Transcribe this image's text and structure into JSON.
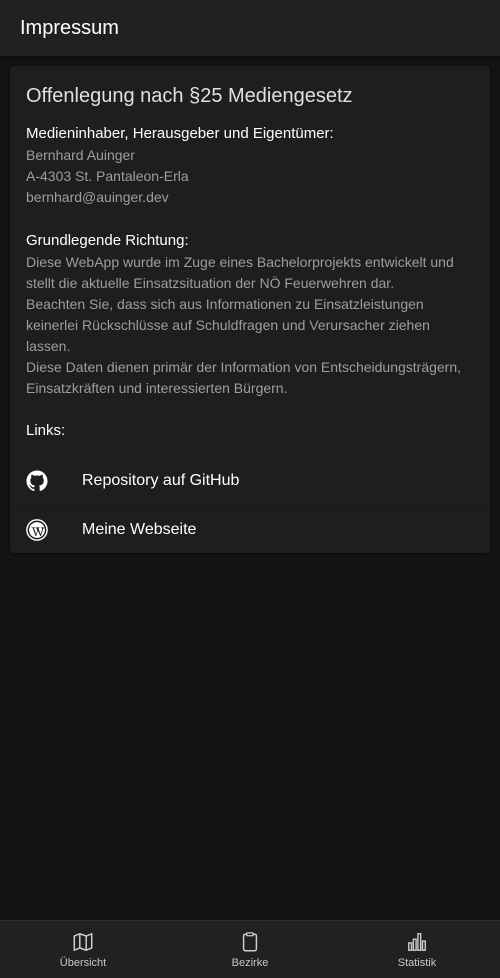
{
  "header": {
    "title": "Impressum"
  },
  "card": {
    "title": "Offenlegung nach §25 Mediengesetz",
    "owner": {
      "heading": "Medieninhaber, Herausgeber und Eigentümer:",
      "lines": [
        "Bernhard Auinger",
        "A-4303 St. Pantaleon-Erla",
        "bernhard@auinger.dev"
      ]
    },
    "direction": {
      "heading": "Grundlegende Richtung:",
      "lines": [
        "Diese WebApp wurde im Zuge eines Bachelorprojekts entwickelt und",
        "stellt die aktuelle Einsatzsituation der NÖ Feuerwehren dar.",
        "Beachten Sie, dass sich aus Informationen zu Einsatzleistungen",
        "keinerlei Rückschlüsse auf Schuldfragen und Verursacher ziehen",
        "lassen.",
        "Diese Daten dienen primär der Information von Entscheidungsträgern,",
        "Einsatzkräften und interessierten Bürgern."
      ]
    },
    "links": {
      "heading": "Links:",
      "items": [
        {
          "label": "Repository auf GitHub",
          "icon": "github-icon"
        },
        {
          "label": "Meine Webseite",
          "icon": "wordpress-icon"
        }
      ]
    }
  },
  "bottom_nav": {
    "items": [
      {
        "label": "Übersicht",
        "icon": "map-icon"
      },
      {
        "label": "Bezirke",
        "icon": "clipboard-icon"
      },
      {
        "label": "Statistik",
        "icon": "bar-chart-icon"
      }
    ]
  },
  "colors": {
    "background": "#131313",
    "surface": "#1e1e1e",
    "bar": "#212121",
    "text_primary": "#ffffff",
    "text_secondary": "#9e9e9e"
  }
}
